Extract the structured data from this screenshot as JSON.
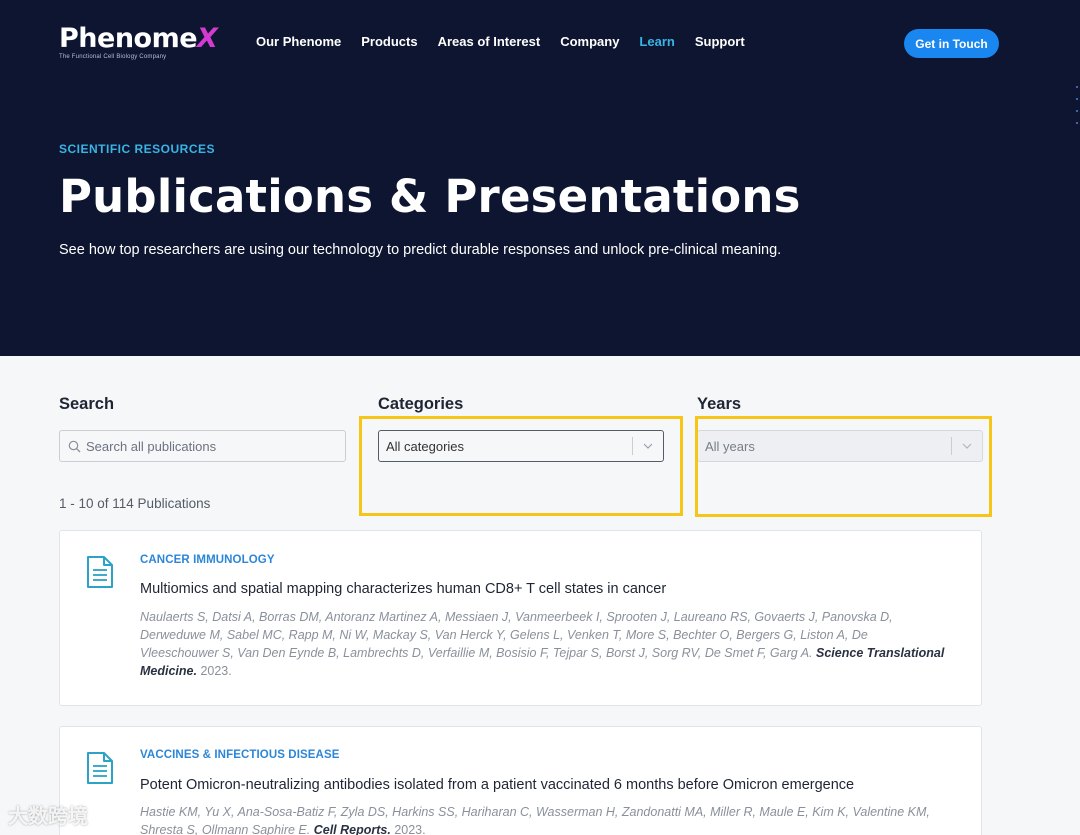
{
  "brand": {
    "logo_word": "Phenome",
    "logo_x": "X",
    "logo_tagline": "The Functional Cell Biology Company"
  },
  "nav": {
    "items": [
      {
        "label": "Our Phenome"
      },
      {
        "label": "Products"
      },
      {
        "label": "Areas of Interest"
      },
      {
        "label": "Company"
      },
      {
        "label": "Learn"
      },
      {
        "label": "Support"
      }
    ],
    "active": "Learn",
    "cta_label": "Get in Touch"
  },
  "hero": {
    "eyebrow": "SCIENTIFIC RESOURCES",
    "title": "Publications & Presentations",
    "subtitle": "See how top researchers are using our technology to predict durable responses and unlock pre-clinical meaning."
  },
  "filters": {
    "search_label": "Search",
    "search_placeholder": "Search all publications",
    "categories_label": "Categories",
    "categories_value": "All categories",
    "years_label": "Years",
    "years_value": "All years"
  },
  "results": {
    "count_text": "1 - 10 of 114 Publications"
  },
  "publications": [
    {
      "category": "CANCER IMMUNOLOGY",
      "title": "Multiomics and spatial mapping characterizes human CD8+ T cell states in cancer",
      "authors": "Naulaerts S, Datsi A, Borras DM, Antoranz Martinez A, Messiaen J, Vanmeerbeek I, Sprooten J, Laureano RS, Govaerts J, Panovska D, Derweduwe M, Sabel MC, Rapp M, Ni W, Mackay S, Van Herck Y, Gelens L, Venken T, More S, Bechter O, Bergers G, Liston A, De Vleeschouwer S, Van Den Eynde B, Lambrechts D, Verfaillie M, Bosisio F, Tejpar S, Borst J, Sorg RV, De Smet F, Garg A.",
      "journal": "Science Translational Medicine.",
      "year": "2023."
    },
    {
      "category": "VACCINES & INFECTIOUS DISEASE",
      "title": "Potent Omicron-neutralizing antibodies isolated from a patient vaccinated 6 months before Omicron emergence",
      "authors": "Hastie KM, Yu X, Ana-Sosa-Batiz F, Zyla DS, Harkins SS, Hariharan C, Wasserman H, Zandonatti MA, Miller R, Maule E, Kim K, Valentine KM, Shresta S, Ollmann Saphire E.",
      "journal": "Cell Reports.",
      "year": "2023."
    }
  ],
  "colors": {
    "hero_bg": "#0d1530",
    "accent": "#39b4e5",
    "cta": "#1a86f0",
    "category": "#2c86d8",
    "highlight": "#f5c518"
  },
  "icons": {
    "search": "search-icon",
    "document": "document-icon",
    "chevron": "chevron-down-icon"
  },
  "watermark": "大数跨境"
}
